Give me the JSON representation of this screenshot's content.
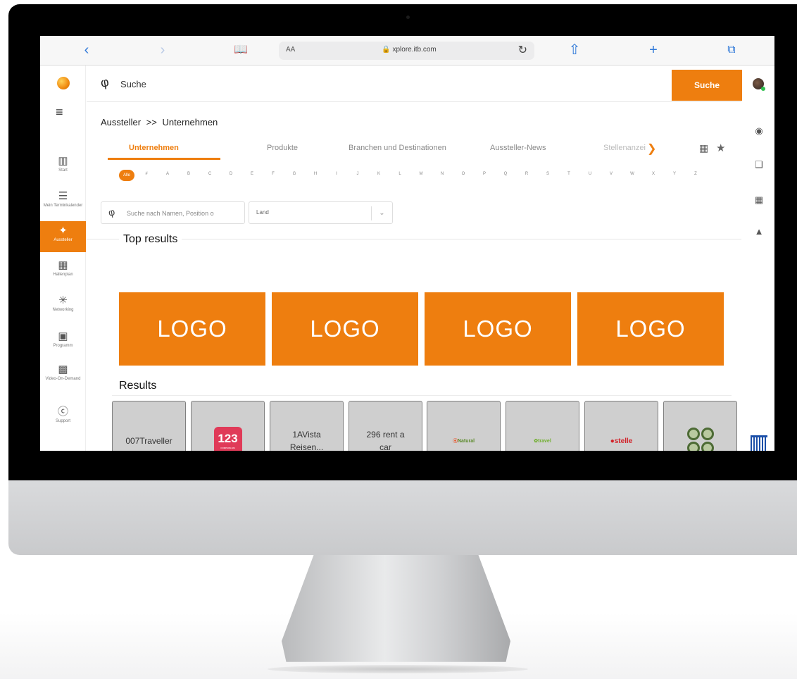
{
  "browser": {
    "text_size_label": "AA",
    "url": "xplore.itb.com",
    "icons": [
      "chevron-left-icon",
      "chevron-right-icon",
      "book-icon",
      "reload-icon",
      "share-icon",
      "plus-icon",
      "tabs-icon"
    ]
  },
  "header": {
    "search_placeholder": "Suche",
    "search_button": "Suche"
  },
  "sidebar": {
    "items": [
      {
        "label": "Start",
        "icon": "podium-icon"
      },
      {
        "label": "Mein Terminkalender",
        "icon": "calendar-person-icon"
      },
      {
        "label": "Aussteller",
        "icon": "exhibitor-icon",
        "active": true
      },
      {
        "label": "Hallenplan",
        "icon": "map-icon"
      },
      {
        "label": "Networking",
        "icon": "network-icon"
      },
      {
        "label": "Programm",
        "icon": "program-icon"
      },
      {
        "label": "Video-On-Demand",
        "icon": "video-icon"
      },
      {
        "label": "Support",
        "icon": "help-icon"
      }
    ]
  },
  "breadcrumb": {
    "parent": "Aussteller",
    "separator": ">>",
    "current": "Unternehmen"
  },
  "tabs": [
    {
      "label": "Unternehmen",
      "active": true
    },
    {
      "label": "Produkte"
    },
    {
      "label": "Branchen und Destinationen"
    },
    {
      "label": "Aussteller-News"
    },
    {
      "label": "Stellenanzeigen"
    }
  ],
  "alphabet": {
    "all_label": "Alle",
    "letters": [
      "#",
      "A",
      "B",
      "C",
      "D",
      "E",
      "F",
      "G",
      "H",
      "I",
      "J",
      "K",
      "L",
      "M",
      "N",
      "O",
      "P",
      "Q",
      "R",
      "S",
      "T",
      "U",
      "V",
      "W",
      "X",
      "Y",
      "Z"
    ]
  },
  "filters": {
    "name_search_placeholder": "Suche nach Namen, Position o",
    "country_select_value": "Land"
  },
  "top_results": {
    "label": "Top results",
    "cards": [
      "LOGO",
      "LOGO",
      "LOGO",
      "LOGO"
    ]
  },
  "results": {
    "label": "Results",
    "cards": [
      {
        "type": "text",
        "name": "007Traveller"
      },
      {
        "type": "logo",
        "logo_text": "123",
        "logo_sub": "COMPARE.ME"
      },
      {
        "type": "text",
        "name": "1AVista Reisen..."
      },
      {
        "type": "text",
        "name": "296 rent a car"
      },
      {
        "type": "logo",
        "logo_text": "Natural"
      },
      {
        "type": "logo",
        "logo_text": "travel"
      },
      {
        "type": "logo",
        "logo_text": "stelle"
      },
      {
        "type": "logo",
        "logo_text": ""
      }
    ]
  },
  "colors": {
    "accent": "#ee7e0f",
    "nav_blue": "#1b4fa8",
    "card_gray": "#cfcfcf"
  }
}
